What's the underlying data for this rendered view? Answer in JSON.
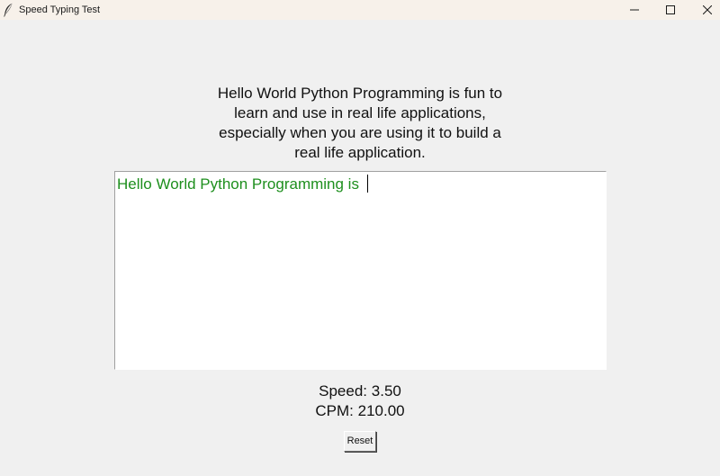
{
  "window": {
    "title": "Speed Typing Test",
    "icon": "feather-icon",
    "controls": {
      "minimize": "minimize-icon",
      "maximize": "maximize-icon",
      "close": "close-icon"
    }
  },
  "prompt": {
    "lines": [
      "Hello World Python Programming is fun to",
      "learn and use in real life applications,",
      "especially when you are using it to build a",
      "real life application."
    ]
  },
  "typing": {
    "value": "Hello World Python Programming is ",
    "text_color": "#1e8f1e"
  },
  "stats": {
    "speed_label": "Speed:",
    "speed_value": "3.50",
    "cpm_label": "CPM:",
    "cpm_value": "210.00"
  },
  "buttons": {
    "reset_label": "Reset"
  }
}
